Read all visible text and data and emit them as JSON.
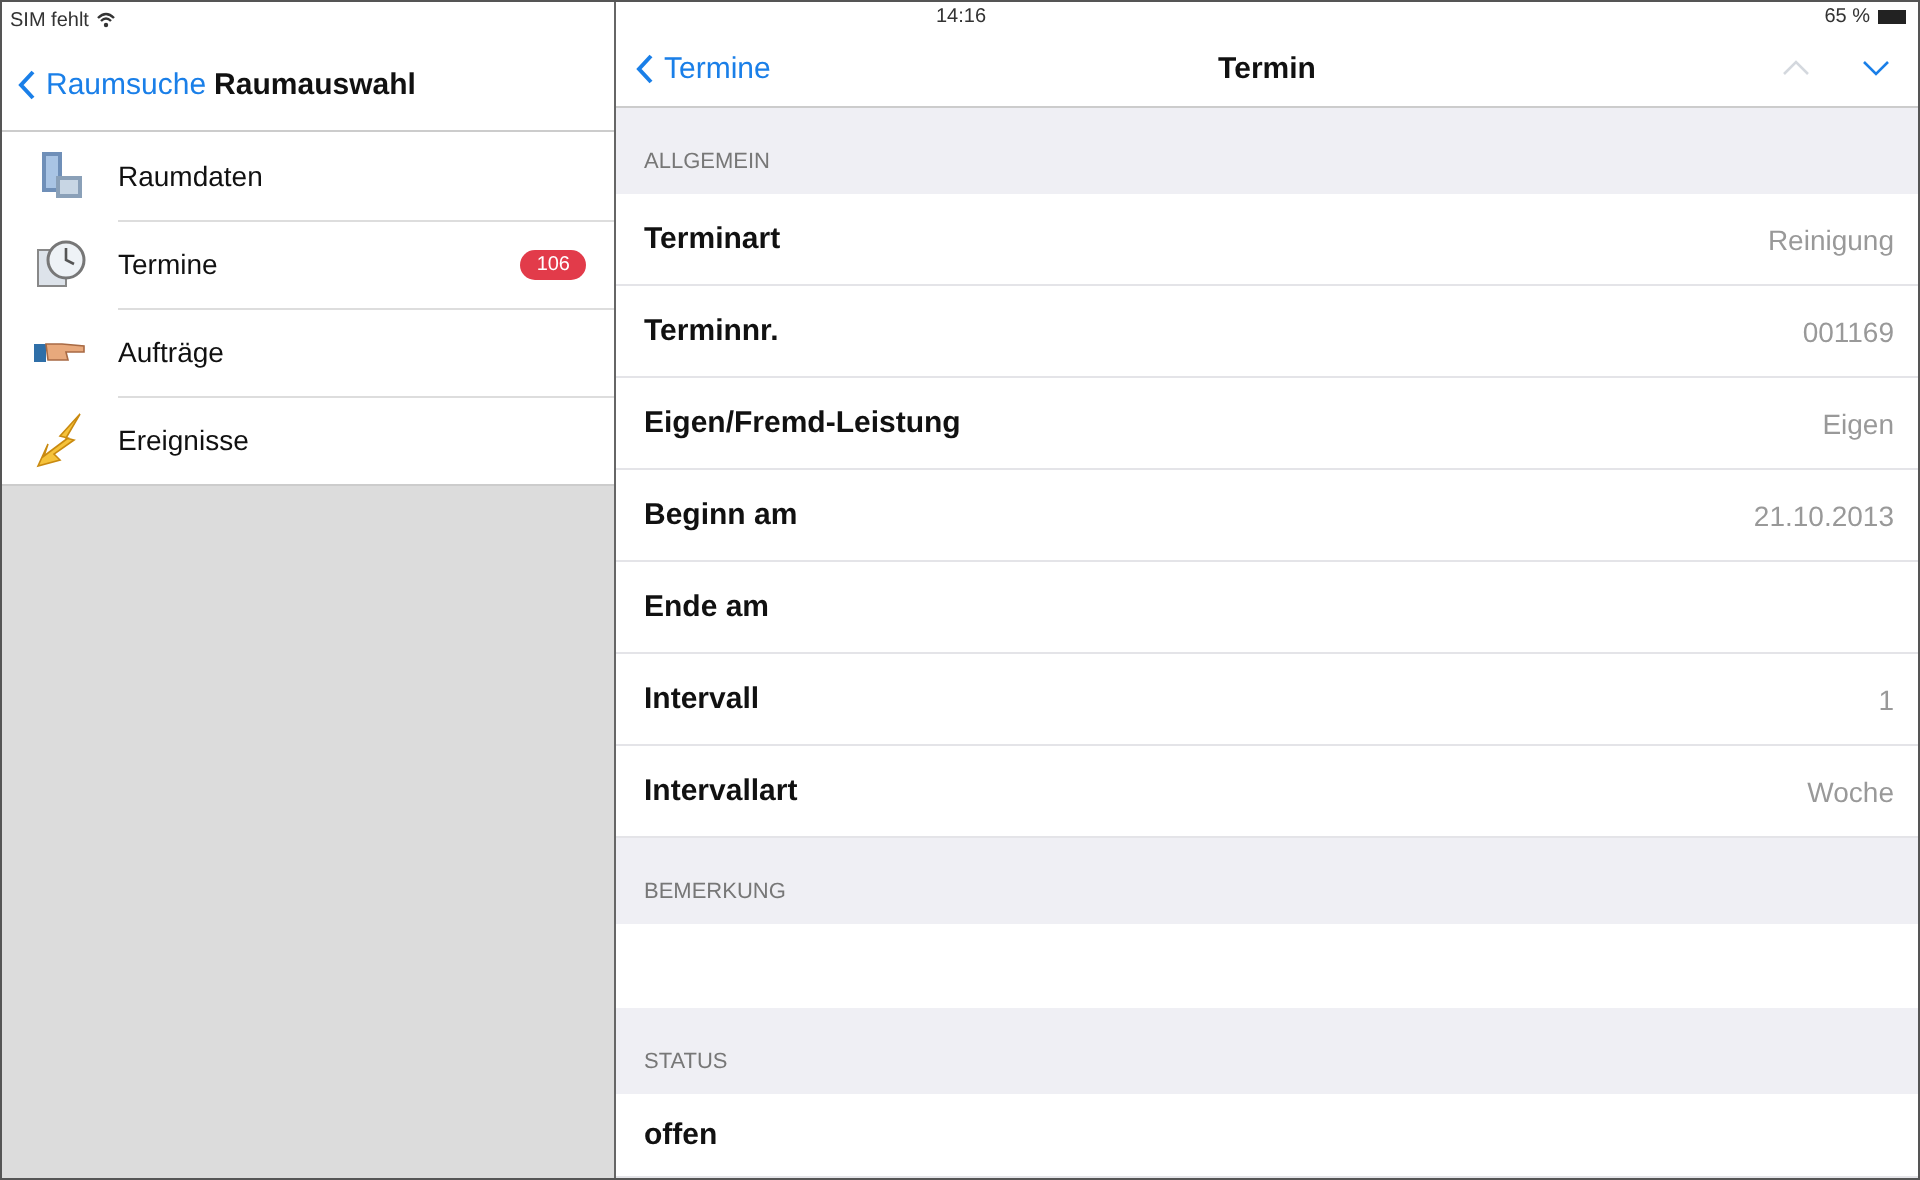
{
  "status_bar": {
    "carrier": "SIM fehlt",
    "time": "14:16",
    "battery": "65 %"
  },
  "sidebar": {
    "back": "Raumsuche",
    "title": "Raumauswahl",
    "items": [
      {
        "kind": "building",
        "label": "Raumdaten"
      },
      {
        "kind": "clock",
        "label": "Termine",
        "badge": "106"
      },
      {
        "kind": "hand",
        "label": "Aufträge"
      },
      {
        "kind": "bolt",
        "label": "Ereignisse"
      }
    ]
  },
  "detail": {
    "back": "Termine",
    "title": "Termin",
    "prev_disabled": true,
    "next_disabled": false,
    "sections": [
      {
        "header": "ALLGEMEIN",
        "kind": "fields",
        "rows": [
          {
            "label": "Terminart",
            "value": "Reinigung"
          },
          {
            "label": "Terminnr.",
            "value": "001169"
          },
          {
            "label": "Eigen/Fremd-Leistung",
            "value": "Eigen"
          },
          {
            "label": "Beginn am",
            "value": "21.10.2013"
          },
          {
            "label": "Ende am"
          },
          {
            "label": "Intervall",
            "value": "1"
          },
          {
            "label": "Intervallart",
            "value": "Woche"
          }
        ]
      },
      {
        "header": "BEMERKUNG",
        "kind": "note"
      },
      {
        "header": "STATUS",
        "kind": "value",
        "text": "offen"
      }
    ]
  }
}
